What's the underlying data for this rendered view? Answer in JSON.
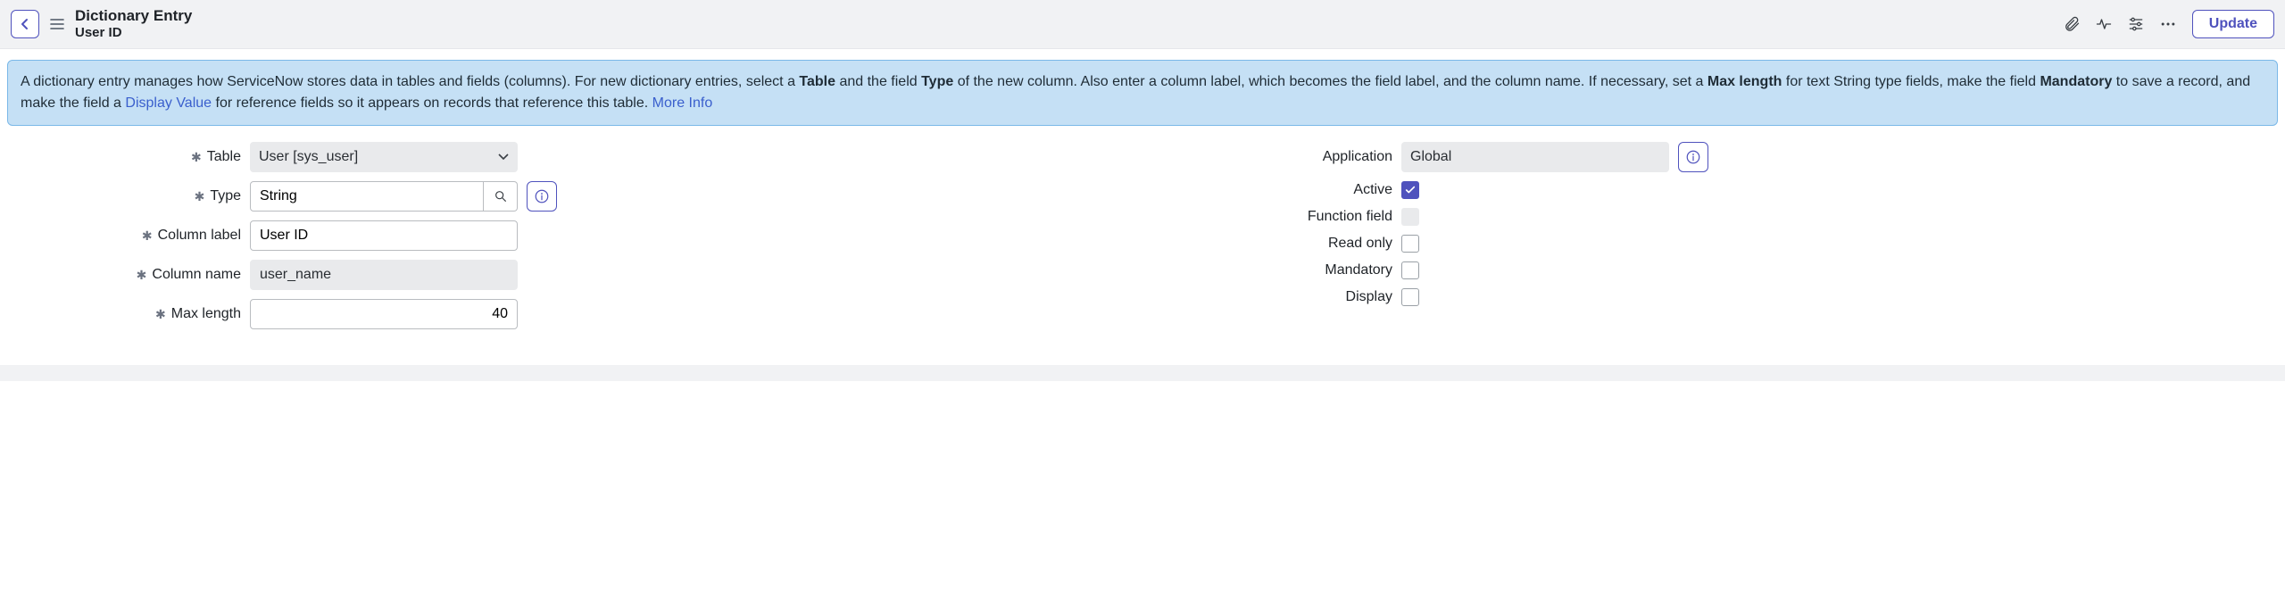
{
  "header": {
    "title_line1": "Dictionary Entry",
    "title_line2": "User ID",
    "update_label": "Update"
  },
  "banner": {
    "text_pre": "A dictionary entry manages how ServiceNow stores data in tables and fields (columns). For new dictionary entries, select a ",
    "bold_table": "Table",
    "text_2": " and the field ",
    "bold_type": "Type",
    "text_3": " of the new column. Also enter a column label, which becomes the field label, and the column name. If necessary, set a ",
    "bold_max": "Max length",
    "text_4": " for text String type fields, make the field ",
    "bold_mand": "Mandatory",
    "text_5": " to save a record, and make the field a ",
    "link_display": "Display Value",
    "text_6": " for reference fields so it appears on records that reference this table. ",
    "more_info": "More Info"
  },
  "form": {
    "left": {
      "table_label": "Table",
      "table_value": "User [sys_user]",
      "type_label": "Type",
      "type_value": "String",
      "col_label_label": "Column label",
      "col_label_value": "User ID",
      "col_name_label": "Column name",
      "col_name_value": "user_name",
      "max_len_label": "Max length",
      "max_len_value": "40"
    },
    "right": {
      "application_label": "Application",
      "application_value": "Global",
      "active_label": "Active",
      "active_checked": true,
      "function_label": "Function field",
      "read_only_label": "Read only",
      "mandatory_label": "Mandatory",
      "display_label": "Display"
    }
  }
}
